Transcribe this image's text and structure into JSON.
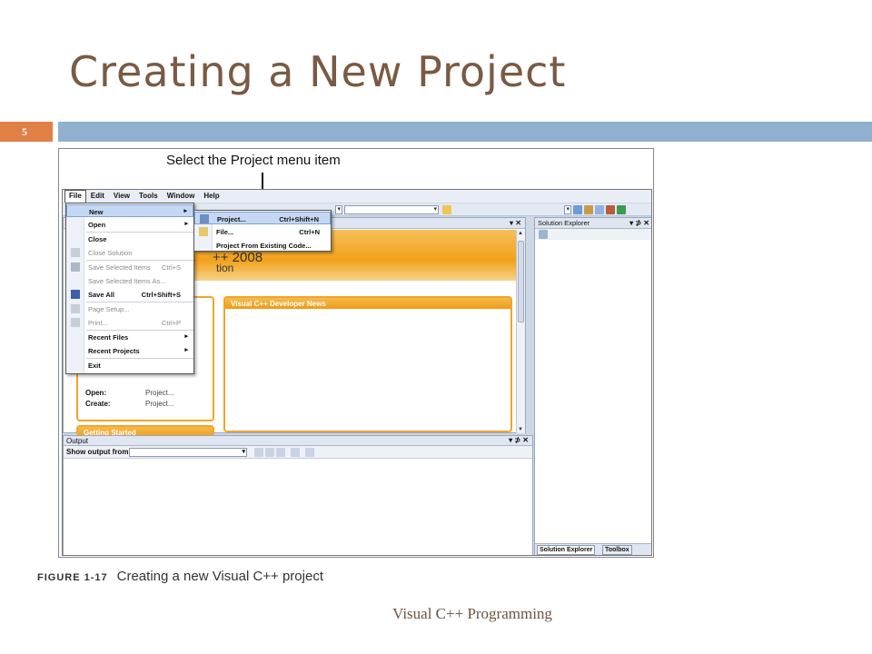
{
  "slide": {
    "title": "Creating a New Project",
    "number": "5",
    "footer": "Visual C++ Programming"
  },
  "figure": {
    "callout": "Select the Project menu item",
    "caption_label": "FIGURE 1-17",
    "caption_text": "Creating a new Visual C++ project"
  },
  "menubar": [
    "File",
    "Edit",
    "View",
    "Tools",
    "Window",
    "Help"
  ],
  "file_menu": {
    "items": [
      {
        "label": "New",
        "shortcut": "",
        "submenu": true,
        "enabled": true
      },
      {
        "label": "Open",
        "shortcut": "",
        "submenu": true,
        "enabled": true
      },
      {
        "label": "Close",
        "shortcut": "",
        "enabled": true
      },
      {
        "label": "Close Solution",
        "shortcut": "",
        "enabled": false
      },
      {
        "label": "Save Selected Items",
        "shortcut": "Ctrl+S",
        "enabled": false
      },
      {
        "label": "Save Selected Items As...",
        "shortcut": "",
        "enabled": false
      },
      {
        "label": "Save All",
        "shortcut": "Ctrl+Shift+S",
        "enabled": true
      },
      {
        "label": "Page Setup...",
        "shortcut": "",
        "enabled": false
      },
      {
        "label": "Print...",
        "shortcut": "Ctrl+P",
        "enabled": false
      },
      {
        "label": "Recent Files",
        "shortcut": "",
        "submenu": true,
        "enabled": true
      },
      {
        "label": "Recent Projects",
        "shortcut": "",
        "submenu": true,
        "enabled": true
      },
      {
        "label": "Exit",
        "shortcut": "",
        "enabled": true
      }
    ]
  },
  "new_submenu": {
    "items": [
      {
        "label": "Project...",
        "shortcut": "Ctrl+Shift+N"
      },
      {
        "label": "File...",
        "shortcut": "Ctrl+N"
      },
      {
        "label": "Project From Existing Code...",
        "shortcut": ""
      }
    ]
  },
  "start_page": {
    "banner_line1": "++ 2008",
    "banner_line2": "tion",
    "news_header": "Visual C++ Developer News",
    "open_label": "Open:",
    "open_value": "Project...",
    "create_label": "Create:",
    "create_value": "Project...",
    "getting_started": "Getting Started"
  },
  "output": {
    "title": "Output",
    "show_from": "Show output from:",
    "controls": "▾ ⊅ ✕"
  },
  "solution_explorer": {
    "title": "Solution Explorer",
    "controls": "▾ ⊅ ✕",
    "tab1": "Solution Explorer",
    "tab2": "Toolbox"
  },
  "doc_controls": "▾ ✕",
  "colors": {
    "title": "#7a5a44",
    "accent_orange": "#e07f46",
    "band_blue": "#8fb0cf",
    "vs_orange": "#f0a52a"
  }
}
